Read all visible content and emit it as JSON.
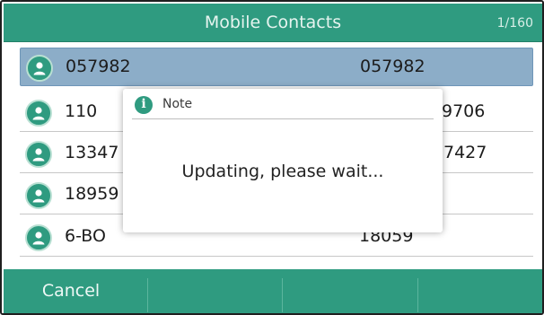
{
  "header": {
    "title": "Mobile Contacts",
    "page_indicator": "1/160"
  },
  "contacts": [
    {
      "name": "057982",
      "number": "057982",
      "selected": true
    },
    {
      "name": "110",
      "number": "9706",
      "selected": false
    },
    {
      "name": "13347",
      "number": "7427",
      "selected": false
    },
    {
      "name": "18959",
      "number": "",
      "selected": false
    },
    {
      "name": "6-BO",
      "number": "18059",
      "selected": false
    }
  ],
  "softkeys": {
    "cancel": "Cancel",
    "key2": "",
    "key3": "",
    "key4": ""
  },
  "dialog": {
    "title": "Note",
    "message": "Updating, please wait...",
    "icon": "info-icon"
  },
  "colors": {
    "accent": "#2f9b80",
    "selected_row": "#8cadc8"
  }
}
